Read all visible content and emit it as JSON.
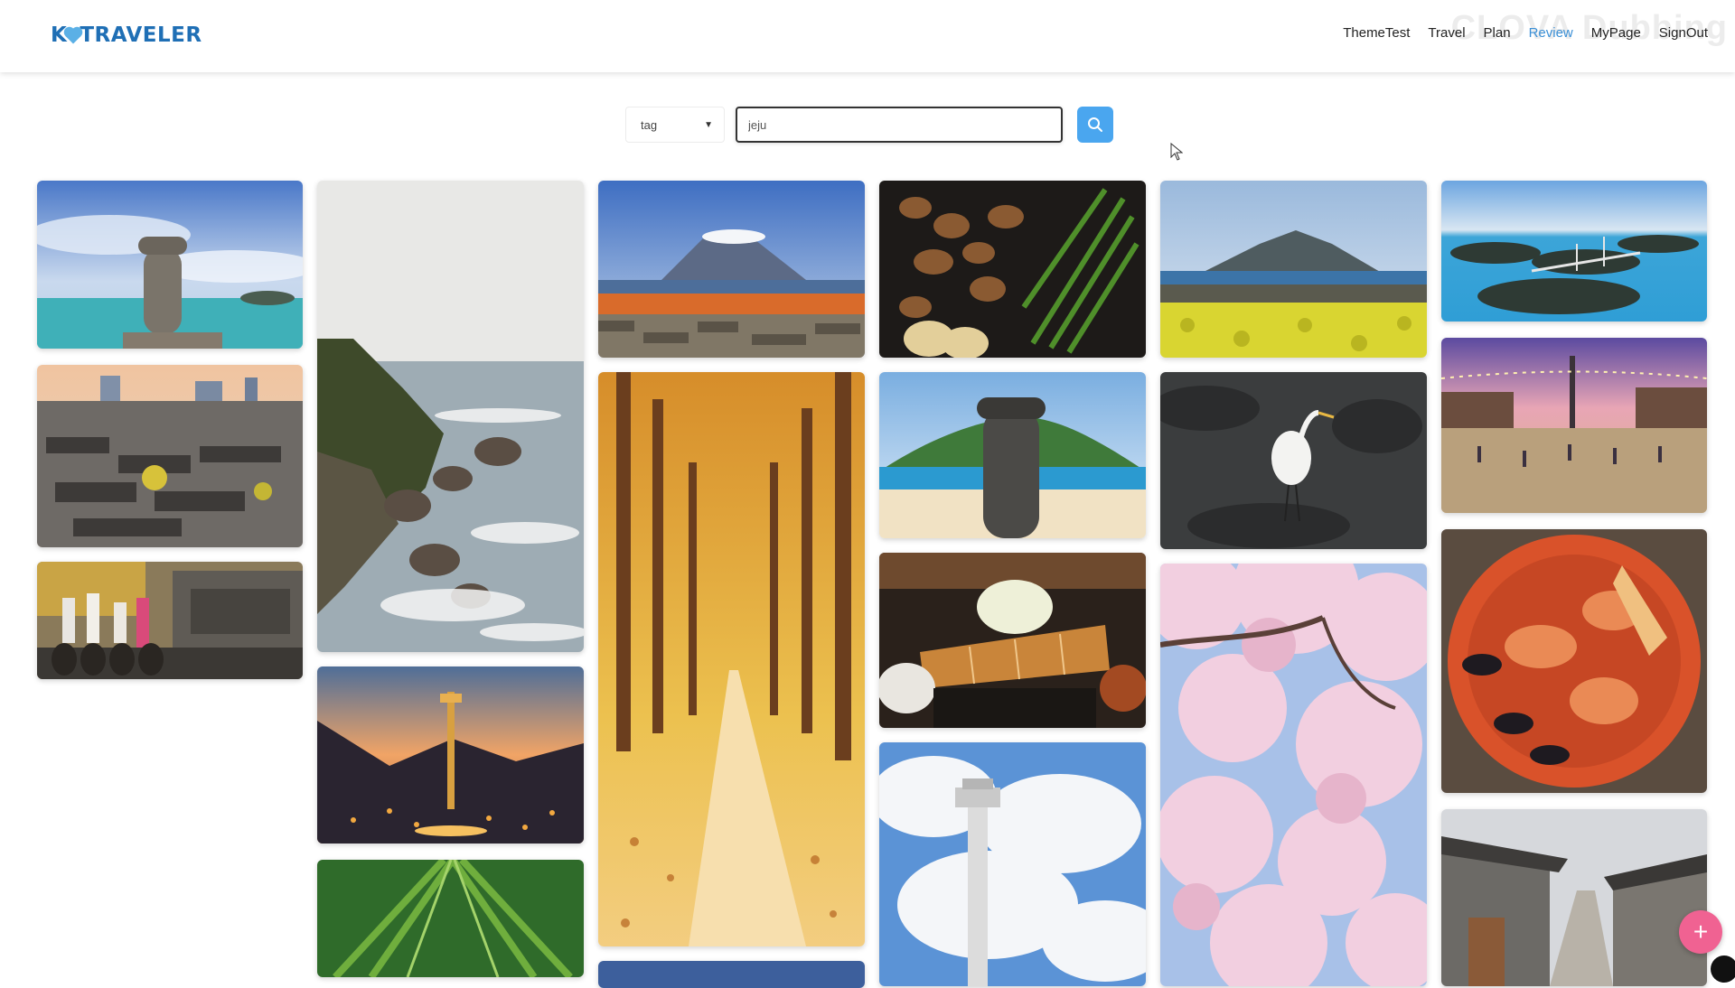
{
  "header": {
    "logo_prefix": "K",
    "logo_suffix": "TRAVELER",
    "nav": [
      {
        "label": "ThemeTest",
        "active": false
      },
      {
        "label": "Travel",
        "active": false
      },
      {
        "label": "Plan",
        "active": false
      },
      {
        "label": "Review",
        "active": true
      },
      {
        "label": "MyPage",
        "active": false
      },
      {
        "label": "SignOut",
        "active": false
      }
    ],
    "watermark": "CLOVA Dubbing"
  },
  "search": {
    "filter_value": "tag",
    "query_value": "jeju",
    "button_icon": "search-icon"
  },
  "colors": {
    "brand": "#1f6fb5",
    "accent": "#3a8fd6",
    "search_button": "#4aa6ef",
    "fab": "#f06292"
  },
  "gallery": {
    "photos": [
      {
        "subject": "stone-statue-sea"
      },
      {
        "subject": "hanok-village-city"
      },
      {
        "subject": "traditional-dress-jars"
      },
      {
        "subject": "rocky-coast-waves"
      },
      {
        "subject": "tower-at-sunset"
      },
      {
        "subject": "green-bamboo"
      },
      {
        "subject": "mountain-stone-wall"
      },
      {
        "subject": "autumn-tree-path"
      },
      {
        "subject": "grilled-meat-pan"
      },
      {
        "subject": "stone-statue-beach"
      },
      {
        "subject": "pork-cutlet-meal"
      },
      {
        "subject": "tower-blue-sky"
      },
      {
        "subject": "mountain-canola-field"
      },
      {
        "subject": "white-heron"
      },
      {
        "subject": "cherry-blossoms"
      },
      {
        "subject": "islands-bridge"
      },
      {
        "subject": "city-square-lights"
      },
      {
        "subject": "seafood-stew"
      },
      {
        "subject": "hanok-alley"
      }
    ]
  },
  "fab": {
    "label": "+"
  }
}
